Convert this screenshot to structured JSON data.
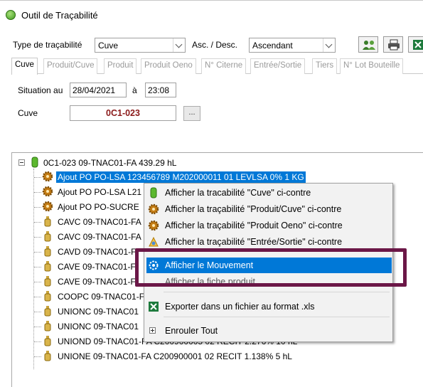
{
  "window": {
    "title": "Outil de Traçabilité"
  },
  "toolbar": {
    "type_label": "Type de traçabilité",
    "type_value": "Cuve",
    "order_label": "Asc. / Desc.",
    "order_value": "Ascendant",
    "buttons": [
      {
        "name": "users-button",
        "icon": "users-icon"
      },
      {
        "name": "print-button",
        "icon": "printer-icon"
      },
      {
        "name": "excel-button",
        "icon": "excel-icon"
      }
    ]
  },
  "tabs": [
    "Cuve",
    "Produit/Cuve",
    "Produit",
    "Produit Oeno",
    "N° Citerne",
    "Entrée/Sortie",
    "Tiers",
    "N° Lot Bouteille"
  ],
  "active_tab": "Cuve",
  "form": {
    "situation_label": "Situation au",
    "date": "28/04/2021",
    "at_label": "à",
    "time": "23:08",
    "cuve_label": "Cuve",
    "cuve_value": "0C1-023",
    "browse_label": "..."
  },
  "tree": {
    "root": "0C1-023  09-TNAC01-FA  439.29 hL",
    "children": [
      {
        "text": "Ajout PO PO-LSA 123456789 M202000011 01 LEVLSA 0% 1 KG",
        "icon": "gear-icon",
        "selected": true
      },
      {
        "text": "Ajout PO PO-LSA L21",
        "icon": "gear-icon"
      },
      {
        "text": "Ajout PO PO-SUCRE",
        "icon": "gear-icon"
      },
      {
        "text": "CAVC 09-TNAC01-FA",
        "icon": "bottle-icon"
      },
      {
        "text": "CAVC 09-TNAC01-FA",
        "icon": "bottle-icon"
      },
      {
        "text": "CAVD 09-TNAC01-F",
        "icon": "bottle-icon"
      },
      {
        "text": "CAVE 09-TNAC01-F",
        "icon": "bottle-icon"
      },
      {
        "text": "CAVE 09-TNAC01-F",
        "icon": "bottle-icon"
      },
      {
        "text": "COOPC 09-TNAC01-F",
        "icon": "bottle-icon"
      },
      {
        "text": "UNIONC 09-TNAC01",
        "icon": "bottle-icon"
      },
      {
        "text": "UNIONC 09-TNAC01",
        "icon": "bottle-icon"
      },
      {
        "text": "UNIOND 09-TNAC01-FA C200900005 02 RECIT 2.276% 10 hL",
        "icon": "bottle-icon"
      },
      {
        "text": "UNIONE 09-TNAC01-FA C200900001 02 RECIT 1.138% 5 hL",
        "icon": "bottle-icon"
      }
    ]
  },
  "context_menu": {
    "items": [
      {
        "label": "Afficher la tracabilité \"Cuve\" ci-contre",
        "icon": "tank-icon"
      },
      {
        "label": "Afficher la traçabilité \"Produit/Cuve\" ci-contre",
        "icon": "gear-icon"
      },
      {
        "label": "Afficher la traçabilité \"Produit Oeno\" ci-contre",
        "icon": "gear-icon"
      },
      {
        "label": "Afficher la traçabilité \"Entrée/Sortie\" ci-contre",
        "icon": "transfer-icon"
      },
      {
        "label": "Afficher le Mouvement",
        "icon": "settings-icon",
        "highlighted": true
      },
      {
        "label": "Afficher la fiche produit",
        "icon": "none"
      },
      {
        "label": "Exporter dans un fichier au format .xls",
        "icon": "excel-icon"
      },
      {
        "label": "Enrouler Tout",
        "icon": "collapse-icon"
      }
    ]
  },
  "colors": {
    "selection": "#0078d7",
    "cuve_text": "#8b1a1a",
    "annotation_frame": "#6b1747"
  }
}
